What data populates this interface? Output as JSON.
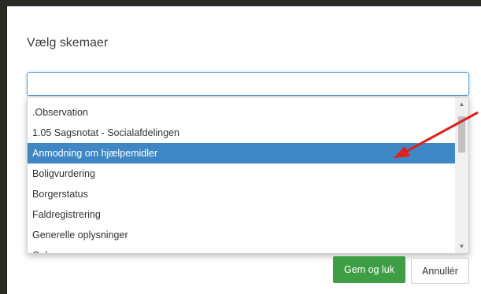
{
  "dialog": {
    "title": "Vælg skemaer",
    "search": {
      "value": "",
      "placeholder": ""
    }
  },
  "list": {
    "items": [
      ".Observation",
      "1.05 Sagsnotat - Socialafdelingen",
      "Anmodning om hjælpemidler",
      "Boligvurdering",
      "Borgerstatus",
      "Faldregistrering",
      "Generelle oplysninger",
      "Gul"
    ],
    "selected_index": 2
  },
  "buttons": {
    "save_label": "Gem og luk",
    "cancel_label": "Annullér"
  },
  "icons": {
    "scroll_up": "triangle-up-icon",
    "scroll_down": "triangle-down-icon",
    "annotation": "red-arrow-icon"
  },
  "colors": {
    "selection": "#3f87c4",
    "save_button": "#3f9e45",
    "annotation_arrow": "#e0201b",
    "focus_border": "#5b9dd9"
  }
}
